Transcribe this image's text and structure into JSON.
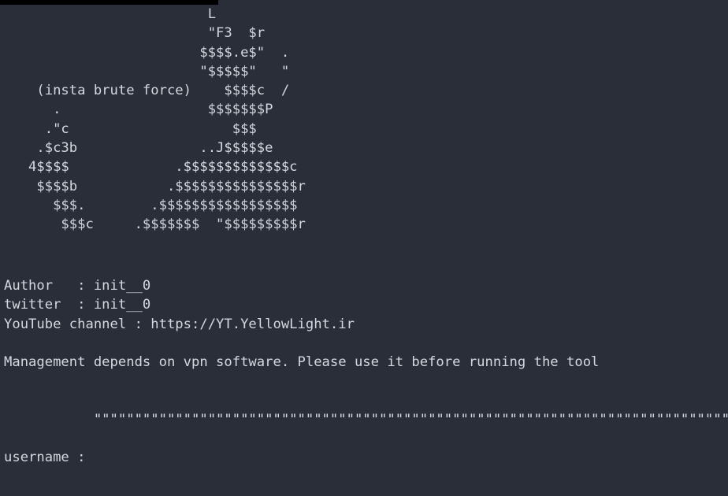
{
  "window": {
    "background_color": "#2a2e39",
    "text_color": "#d4d8df",
    "title_strip_color": "#000000"
  },
  "banner": {
    "art_lines": [
      "                         L",
      "                         \"F3  $r",
      "                        $$$$.e$\"  .",
      "                        \"$$$$$\"   \"",
      "    (insta brute force)    $$$$c  /",
      "      .                  $$$$$$$P",
      "     .\"c                    $$$",
      "    .$c3b               ..J$$$$$e",
      "   4$$$$             .$$$$$$$$$$$$$c",
      "    $$$$b           .$$$$$$$$$$$$$$$r",
      "      $$$.        .$$$$$$$$$$$$$$$$$",
      "       $$$c     .$$$$$$$  \"$$$$$$$$$r"
    ],
    "art_text": "                         L\n                         \"F3  $r\n                        $$$$.e$\"  .\n                        \"$$$$$\"   \"\n    (insta brute force)    $$$$c  /\n      .                  $$$$$$$P\n     .\"c                    $$$\n    .$c3b               ..J$$$$$e\n   4$$$$             .$$$$$$$$$$$$$c\n    $$$$b           .$$$$$$$$$$$$$$$r\n      $$$.        .$$$$$$$$$$$$$$$$$\n       $$$c     .$$$$$$$  \"$$$$$$$$$r",
    "tool_tagline": "(insta brute force)"
  },
  "credits": {
    "author_label": "Author",
    "author_value": "init__0",
    "twitter_label": "twitter",
    "twitter_value": "init__0",
    "youtube_label": "YouTube channel",
    "youtube_value": "https://YT.YellowLight.ir",
    "text": "Author   : init__0\ntwitter  : init__0\nYouTube channel : https://YT.YellowLight.ir"
  },
  "notice": {
    "text": "Management depends on vpn software. Please use it before running the tool"
  },
  "divider": {
    "character": "\"",
    "count": 44,
    "text": "           \"\"\"\"\"\"\"\"\"\"\"\"\"\"\"\"\"\"\"\"\"\"\"\"\"\"\"\"\"\"\"\"\"\"\"\"\"\"\"\"\"\"\"\"\"\"\"\"\"\"\"\"\"\"\"\"\"\"\"\"\"\"\"\"\"\"\"\"\"\"\"\"\"\"\"\"\"\"\""
  },
  "prompt": {
    "label": "username :",
    "value": "",
    "placeholder": ""
  }
}
